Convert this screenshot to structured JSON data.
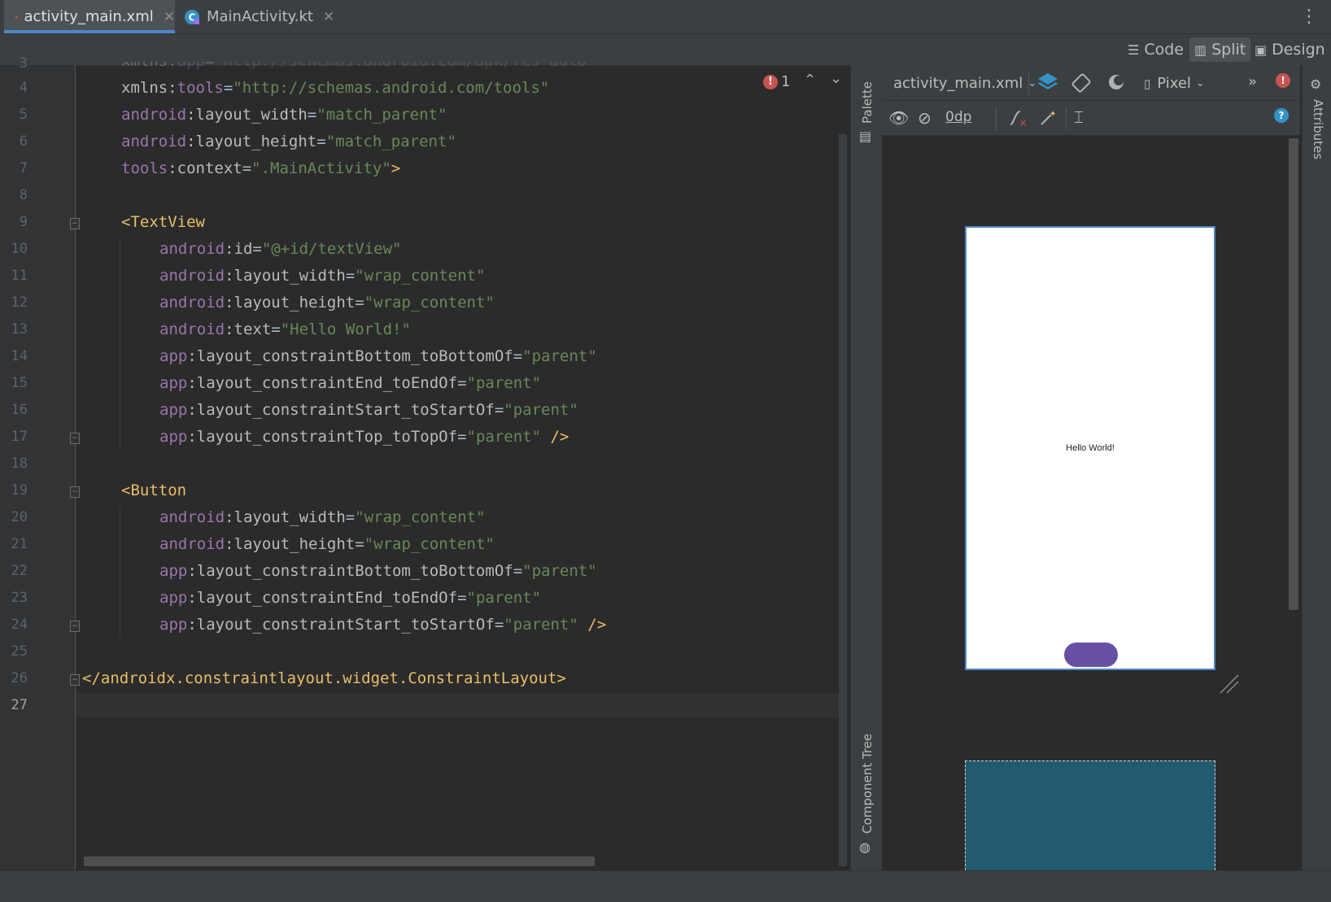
{
  "tabs": [
    {
      "label": "activity_main.xml",
      "active": true,
      "icon": "xml-layout-icon"
    },
    {
      "label": "MainActivity.kt",
      "active": false,
      "icon": "kotlin-class-icon"
    }
  ],
  "view_modes": [
    {
      "label": "Code",
      "icon": "code-view-icon",
      "selected": false
    },
    {
      "label": "Split",
      "icon": "split-view-icon",
      "selected": true
    },
    {
      "label": "Design",
      "icon": "design-view-icon",
      "selected": false
    }
  ],
  "editor": {
    "partial_line_number": "3",
    "partial_line_text": "xmlns:app=\"http://schemas.android.com/apk/res-auto\"",
    "current_line": "27",
    "error_count": "1",
    "lines": [
      {
        "n": "4"
      },
      {
        "n": "5"
      },
      {
        "n": "6"
      },
      {
        "n": "7"
      },
      {
        "n": "8"
      },
      {
        "n": "9"
      },
      {
        "n": "10"
      },
      {
        "n": "11"
      },
      {
        "n": "12"
      },
      {
        "n": "13"
      },
      {
        "n": "14"
      },
      {
        "n": "15"
      },
      {
        "n": "16"
      },
      {
        "n": "17"
      },
      {
        "n": "18"
      },
      {
        "n": "19"
      },
      {
        "n": "20"
      },
      {
        "n": "21"
      },
      {
        "n": "22"
      },
      {
        "n": "23"
      },
      {
        "n": "24"
      },
      {
        "n": "25"
      },
      {
        "n": "26"
      },
      {
        "n": "27"
      }
    ]
  },
  "design": {
    "file_selector": "activity_main.xml",
    "device_selector": "Pixel",
    "margin_value": "0dp",
    "palette_label": "Palette",
    "component_tree_label": "Component Tree",
    "attributes_label": "Attributes",
    "preview_text": "Hello World!"
  },
  "colors": {
    "accent": "#4a88c7",
    "button_purple": "#6750a4",
    "blueprint": "#225b70",
    "error": "#c75450"
  }
}
